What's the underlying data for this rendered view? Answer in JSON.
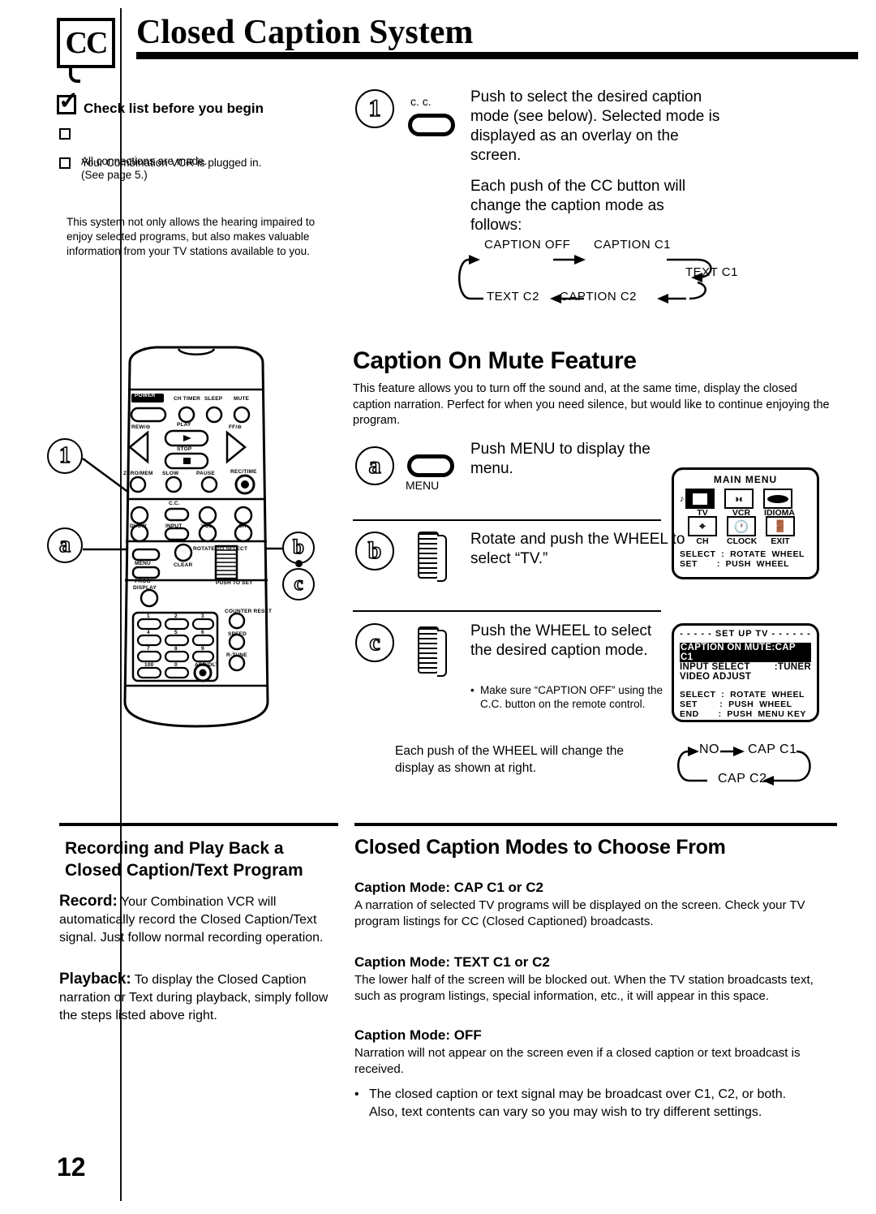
{
  "header": {
    "badge": "CC",
    "title": "Closed Caption System"
  },
  "checklist": {
    "title": "Check list before you begin",
    "items": [
      "All connections are made.\n(See page 5.)",
      "Your Combination VCR is plugged in."
    ]
  },
  "intro_paragraph": "This system not only allows the hearing impaired to enjoy selected programs, but also makes valuable information from your TV stations available to you.",
  "step1": {
    "marker": "1",
    "button_label": "c. c.",
    "text": "Push to select the desired caption mode (see below). Selected mode is displayed as an overlay on the screen.",
    "text2": "Each push of the CC button will change the caption mode as follows:",
    "flow": {
      "node1": "CAPTION OFF",
      "node2": "CAPTION C1",
      "node3": "TEXT C1",
      "node4": "CAPTION C2",
      "node5": "TEXT C2"
    }
  },
  "mute_feature": {
    "heading": "Caption On Mute Feature",
    "paragraph": "This feature allows you to turn off the sound and, at the same time, display the closed caption narration. Perfect for when you need silence, but would like to continue enjoying the program.",
    "step_a": {
      "marker": "a",
      "button_label": "MENU",
      "text": "Push MENU to display the menu."
    },
    "step_b": {
      "marker": "b",
      "text": "Rotate and push the WHEEL to select “TV.”"
    },
    "step_c": {
      "marker": "c",
      "text": "Push the WHEEL to select the desired caption mode.",
      "note": "Make sure “CAPTION OFF” using the C.C. button on the remote control."
    },
    "wheel_note": "Each push of the WHEEL will change the display as shown at right.",
    "wheel_flow": {
      "node1": "NO",
      "node2": "CAP C1",
      "node3": "CAP C2"
    }
  },
  "main_menu_osd": {
    "title": "MAIN MENU",
    "icons": [
      {
        "label": "TV",
        "glyph": "tv-icon",
        "selected": true
      },
      {
        "label": "VCR",
        "glyph": "vcr-icon",
        "selected": false
      },
      {
        "label": "IDIOMA",
        "glyph": "language-icon",
        "selected": false
      },
      {
        "label": "CH",
        "glyph": "antenna-icon",
        "selected": false
      },
      {
        "label": "CLOCK",
        "glyph": "clock-icon",
        "selected": false
      },
      {
        "label": "EXIT",
        "glyph": "exit-icon",
        "selected": false
      }
    ],
    "legend": [
      "SELECT  :  ROTATE  WHEEL",
      "SET       :  PUSH  WHEEL"
    ]
  },
  "setup_tv_osd": {
    "title": "- - - - -  SET UP TV  - - - - - -",
    "rows": [
      {
        "label": "CAPTION ON MUTE",
        "value": ":CAP C1",
        "highlighted": true
      },
      {
        "label": "INPUT SELECT",
        "value": ":TUNER",
        "highlighted": false
      },
      {
        "label": "VIDEO ADJUST",
        "value": "",
        "highlighted": false
      }
    ],
    "legend": [
      "SELECT  :  ROTATE  WHEEL",
      "SET        :  PUSH  WHEEL",
      "END       :  PUSH  MENU KEY"
    ]
  },
  "remote": {
    "callouts": {
      "one": "1",
      "a": "a",
      "b": "b",
      "c": "c"
    },
    "top_row": [
      "POWER",
      "CH TIMER",
      "SLEEP",
      "MUTE"
    ],
    "transport": [
      "REW",
      "PLAY",
      "FF",
      "STOP"
    ],
    "labels": {
      "rew": "REW/⊝",
      "play": "PLAY",
      "ff": "FF/⊝",
      "stop": "STOP",
      "zero": "ZERO/MEM",
      "slow": "SLOW",
      "pause": "PAUSE",
      "rec": "REC/TIME",
      "cc": "C.C.",
      "dlow": "DLOW",
      "input": "INPUT",
      "vol": "VOL",
      "ch": "CH",
      "menu": "MENU",
      "clear": "CLEAR",
      "prog": "PROG",
      "rotate": "ROTATE TO SELECT",
      "push": "PUSH TO SET",
      "display": "DISPLAY",
      "counter": "COUNTER RESET",
      "speed": "SPEED",
      "rtune": "R-TUNE",
      "keys": [
        "1",
        "2",
        "3",
        "4",
        "5",
        "6",
        "7",
        "8",
        "9",
        "100",
        "0",
        "ADD/DLT"
      ]
    }
  },
  "recording_section": {
    "heading": "Recording and Play Back a\nClosed Caption/Text Program",
    "record_label": "Record:",
    "record_text": "Your Combination VCR will automatically record the Closed Caption/Text signal.  Just follow normal recording operation.",
    "playback_label": "Playback:",
    "playback_text": "To display the Closed Caption narration or Text during playback, simply follow the steps listed above right."
  },
  "modes_section": {
    "heading": "Closed Caption Modes to Choose From",
    "modes": [
      {
        "title": "Caption Mode: CAP C1 or C2",
        "body": "A narration of selected TV programs will be displayed on the screen. Check your TV program listings for CC (Closed Captioned) broadcasts."
      },
      {
        "title": "Caption Mode: TEXT C1 or C2",
        "body": "The lower half of the screen will be blocked out. When the TV station broadcasts text, such as program listings, special information, etc., it will appear in this space."
      },
      {
        "title": "Caption Mode: OFF",
        "body": "Narration will not appear on the screen even if a closed caption or text broadcast is received."
      }
    ],
    "bullet": "The closed caption or text signal may be broadcast over C1, C2, or both. Also, text contents can vary so you may wish to try different settings."
  },
  "page_number": "12"
}
